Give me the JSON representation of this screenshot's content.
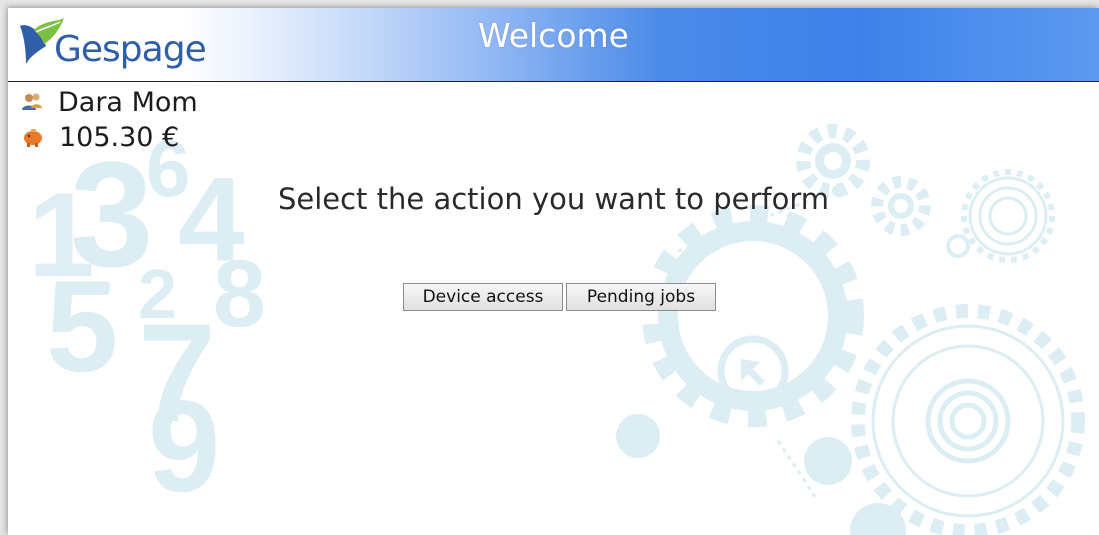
{
  "brand": {
    "logo_text": "Gespage",
    "logo_icon": "leaf-icon"
  },
  "header": {
    "title": "Welcome"
  },
  "user": {
    "name": "Dara Mom",
    "icon": "user-icon"
  },
  "credit": {
    "balance": "105.30 €",
    "icon": "piggy-bank-icon"
  },
  "main": {
    "prompt": "Select the action you want to perform",
    "device_access_label": "Device access",
    "pending_jobs_label": "Pending jobs"
  },
  "background": {
    "numbers": [
      "1",
      "3",
      "6",
      "4",
      "2",
      "5",
      "8",
      "7",
      "9"
    ]
  },
  "colors": {
    "header_blue": "#3d82ea",
    "logo_blue": "#2f5fa9",
    "decor": "#dceff5"
  }
}
